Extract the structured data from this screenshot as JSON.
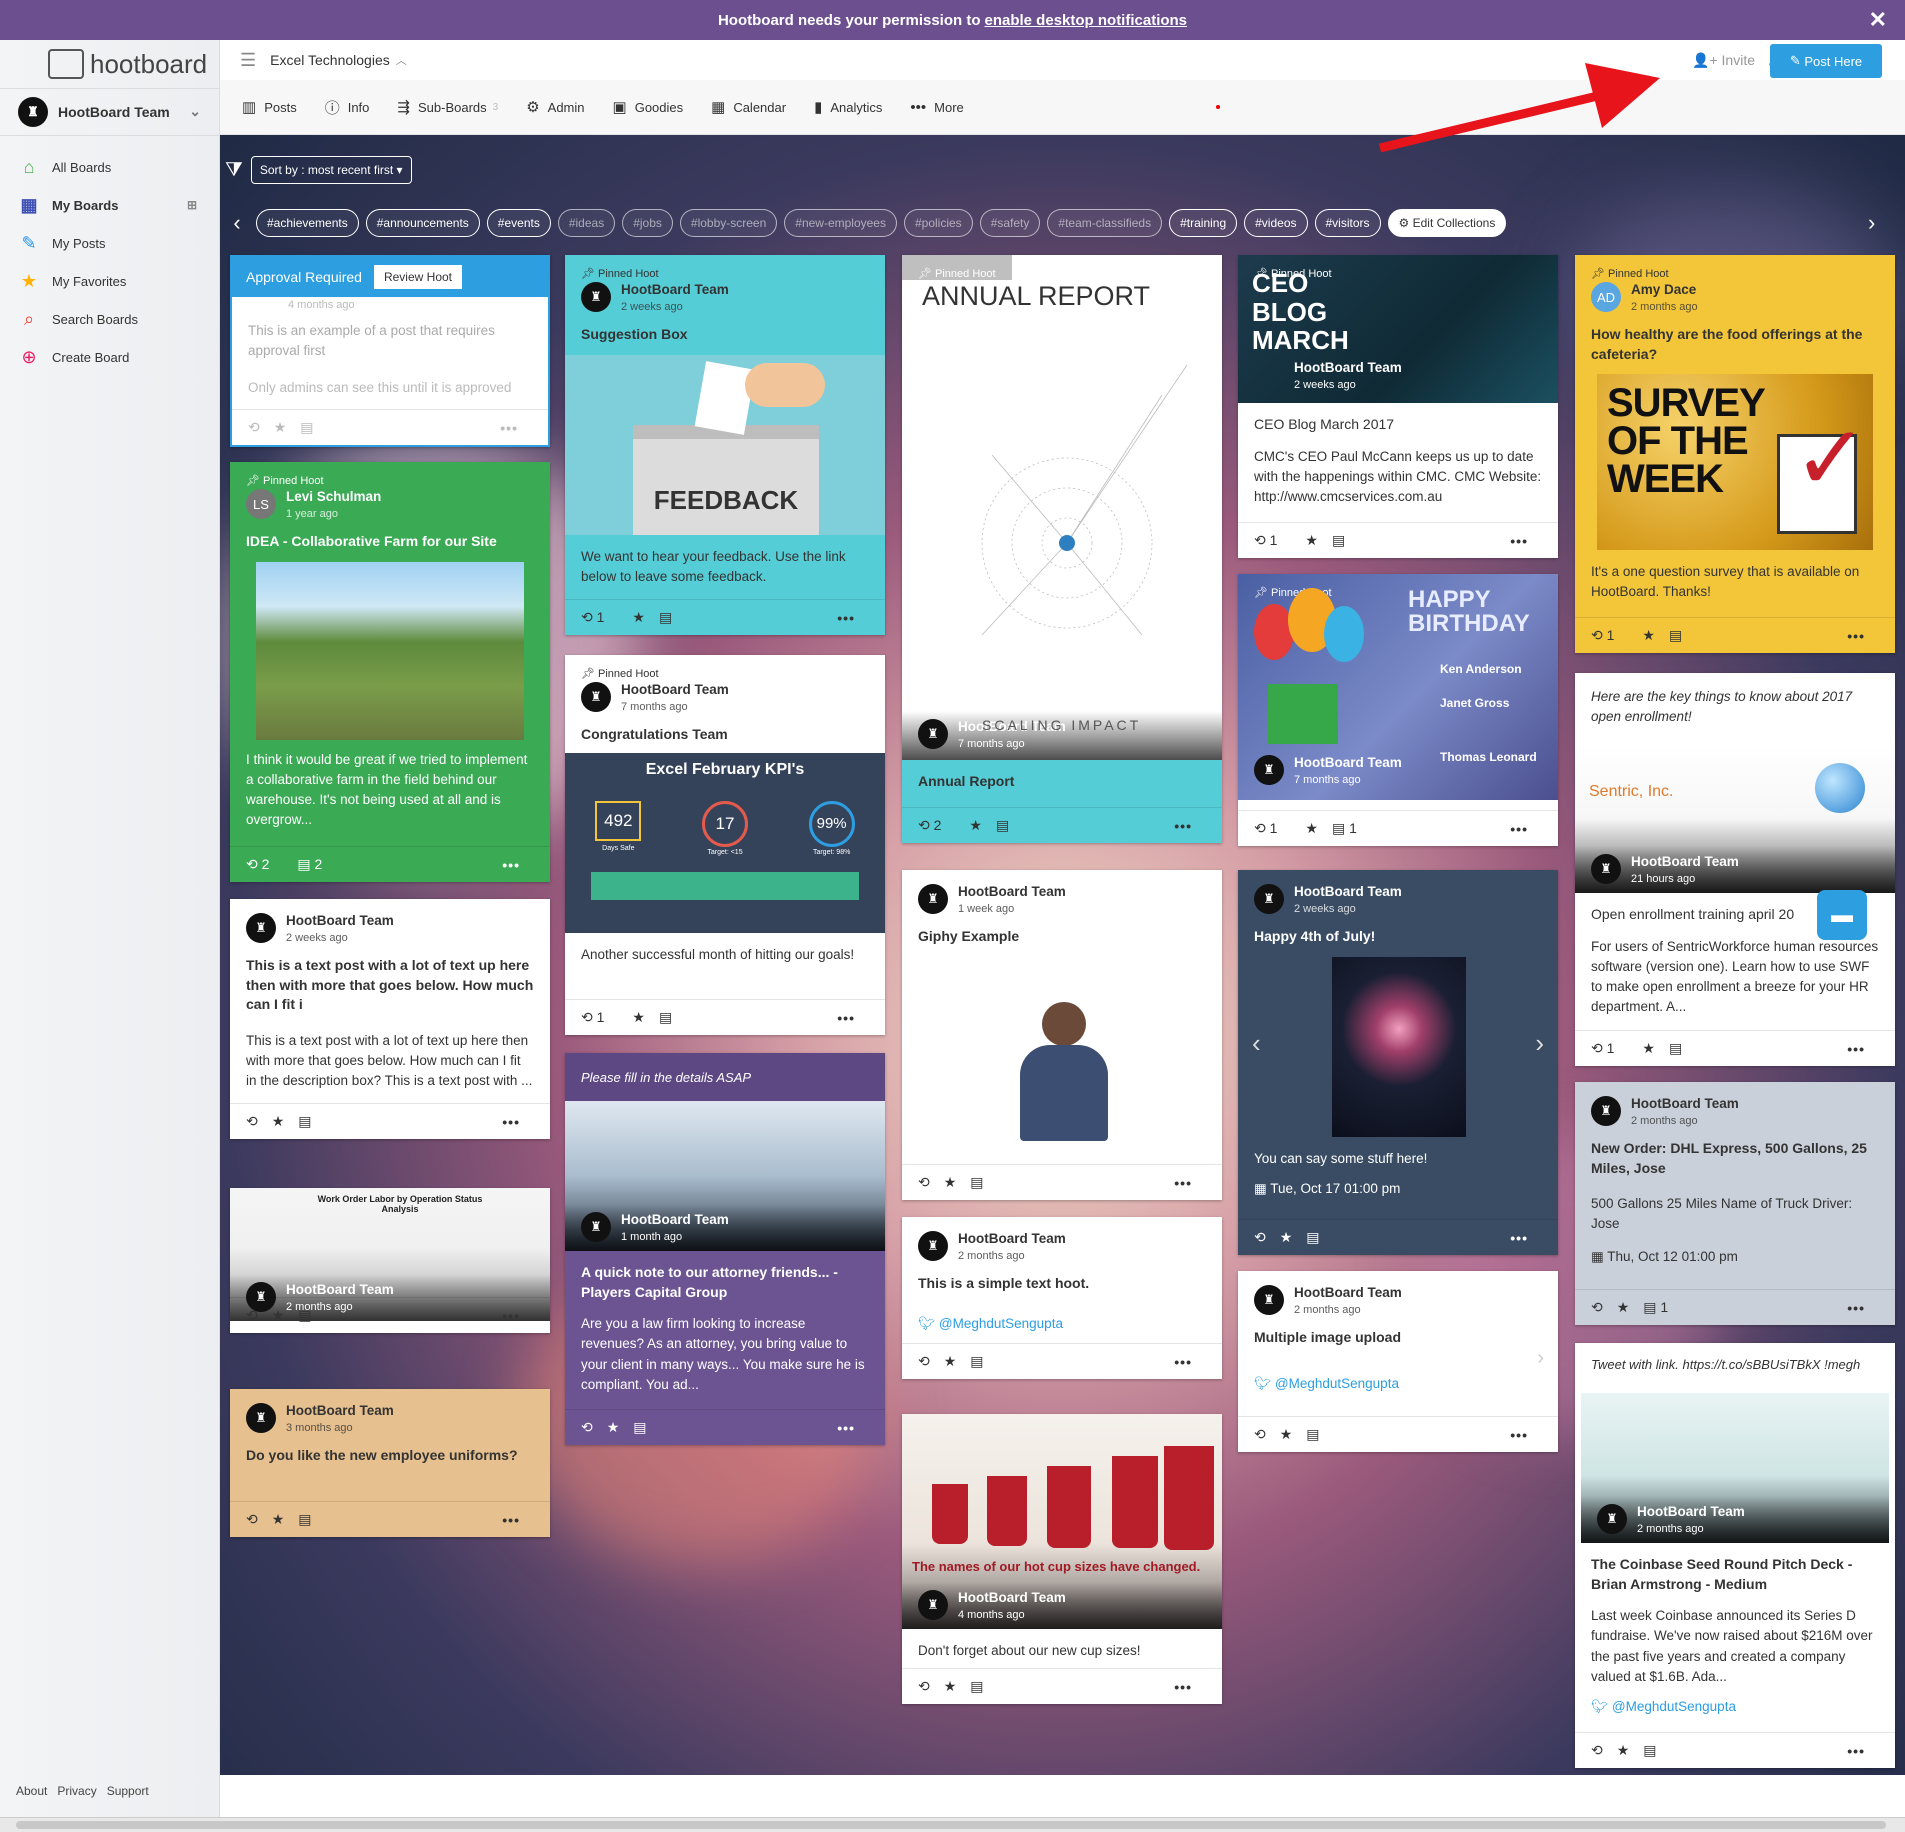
{
  "banner": {
    "text": "Hootboard needs your permission to",
    "link": "enable desktop notifications"
  },
  "app": {
    "logo": "hootboard",
    "team": "HootBoard Team",
    "board": "Excel Technologies"
  },
  "sidebar": {
    "items": [
      {
        "label": "All Boards",
        "icon": "home-icon",
        "color": "#4caf50"
      },
      {
        "label": "My Boards",
        "icon": "boards-icon",
        "color": "#3f51b5"
      },
      {
        "label": "My Posts",
        "icon": "edit-icon",
        "color": "#2196f3"
      },
      {
        "label": "My Favorites",
        "icon": "star-icon",
        "color": "#ffb300"
      },
      {
        "label": "Search Boards",
        "icon": "search-icon",
        "color": "#f44336"
      },
      {
        "label": "Create Board",
        "icon": "plus-icon",
        "color": "#e91e63"
      }
    ],
    "footer": [
      "About",
      "Privacy",
      "Support"
    ]
  },
  "top": {
    "invite": "Invite",
    "post": "Post Here"
  },
  "tabs": [
    {
      "label": "Posts",
      "icon": "▥"
    },
    {
      "label": "Info",
      "icon": "ⓘ"
    },
    {
      "label": "Sub-Boards",
      "icon": "⇶",
      "count": "3"
    },
    {
      "label": "Admin",
      "icon": "⚙"
    },
    {
      "label": "Goodies",
      "icon": "▣"
    },
    {
      "label": "Calendar",
      "icon": "▦"
    },
    {
      "label": "Analytics",
      "icon": "▮"
    },
    {
      "label": "More",
      "icon": "•••"
    }
  ],
  "sort": "Sort by : most recent first",
  "tags": [
    "#achievements",
    "#announcements",
    "#events",
    "#ideas",
    "#jobs",
    "#lobby-screen",
    "#new-employees",
    "#policies",
    "#safety",
    "#team-classifieds",
    "#training",
    "#videos",
    "#visitors"
  ],
  "edit_collections": "Edit Collections",
  "cards": {
    "approval": {
      "label": "Approval Required",
      "review": "Review Hoot",
      "time": "4 months ago",
      "text": "This is an example of a post that requires approval first",
      "note": "Only admins can see this until it is approved"
    },
    "levi": {
      "pin": "Pinned Hoot",
      "name": "Levi Schulman",
      "time": "1 year ago",
      "title": "IDEA - Collaborative Farm for our Site",
      "text": "I think it would be great if we tried to implement a collaborative farm in the field behind our warehouse. It's not being used at all and is overgrow...",
      "r": "2",
      "c": "2"
    },
    "textpost": {
      "name": "HootBoard Team",
      "time": "2 weeks ago",
      "title": "This is a text post with a lot of text up here then with more that goes below. How much can I fit i",
      "text": "This is a text post with a lot of text up here then with more that goes below. How much can I fit in the description box? This is a text post with ..."
    },
    "workorder": {
      "name": "HootBoard Team",
      "time": "2 months ago",
      "img_title": "Work Order Labor by Operation Status Analysis"
    },
    "uniform": {
      "name": "HootBoard Team",
      "time": "3 months ago",
      "title": "Do you like the new employee uniforms?"
    },
    "suggest": {
      "pin": "Pinned Hoot",
      "name": "HootBoard Team",
      "time": "2 weeks ago",
      "title": "Suggestion Box",
      "img": "FEEDBACK",
      "text": "We want to hear your feedback. Use the link below to leave some feedback.",
      "r": "1"
    },
    "congrats": {
      "pin": "Pinned Hoot",
      "name": "HootBoard Team",
      "time": "7 months ago",
      "title": "Congratulations Team",
      "kpi_title": "Excel February KPI's",
      "k1": "492",
      "k2": "17",
      "k3": "99%",
      "k1l": "Days Safe",
      "k2l": "Target: <15",
      "k3l": "Target: 98%",
      "text": "Another successful month of hitting our goals!",
      "r": "1"
    },
    "attorney": {
      "header": "Please fill in the details ASAP",
      "name": "HootBoard Team",
      "time": "1 month ago",
      "title": "A quick note to our attorney friends... - Players Capital Group",
      "text": "Are you a law firm looking to increase revenues? As an attorney, you bring value to your client in many ways... You make sure he is compliant. You ad..."
    },
    "annual": {
      "pin": "Pinned Hoot",
      "img_title": "ANNUAL REPORT",
      "img_sub": "SCALING IMPACT",
      "name": "HootBoard Team",
      "time": "7 months ago",
      "title": "Annual Report",
      "r": "2"
    },
    "giphy": {
      "name": "HootBoard Team",
      "time": "1 week ago",
      "title": "Giphy Example"
    },
    "simple": {
      "name": "HootBoard Team",
      "time": "2 months ago",
      "title": "This is a simple text hoot.",
      "tw": "@MeghdutSengupta"
    },
    "cups": {
      "name": "HootBoard Team",
      "time": "4 months ago",
      "img_title": "The names of our hot cup sizes have changed.",
      "text": "Don't forget about our new cup sizes!"
    },
    "ceo": {
      "pin": "Pinned Hoot",
      "img_title": "CEO BLOG MARCH",
      "name": "HootBoard Team",
      "time": "2 weeks ago",
      "title": "CEO Blog March 2017",
      "text": "CMC's CEO Paul McCann keeps us up to date with the happenings within CMC. CMC Website: http://www.cmcservices.com.au",
      "r": "1"
    },
    "birthday": {
      "pin": "Pinned Hoot",
      "img_title": "HAPPY BIRTHDAY",
      "p1": "Ken Anderson",
      "p2": "Janet Gross",
      "p3": "Thomas Leonard",
      "name": "HootBoard Team",
      "time": "7 months ago",
      "r": "1",
      "c": "1"
    },
    "july": {
      "name": "HootBoard Team",
      "time": "2 weeks ago",
      "title": "Happy 4th of July!",
      "text": "You can say some stuff here!",
      "date": "Tue, Oct 17 01:00 pm"
    },
    "multi": {
      "name": "HootBoard Team",
      "time": "2 months ago",
      "title": "Multiple image upload",
      "tw": "@MeghdutSengupta"
    },
    "survey": {
      "pin": "Pinned Hoot",
      "av": "AD",
      "name": "Amy Dace",
      "time": "2 months ago",
      "title": "How healthy are the food offerings at the cafeteria?",
      "img": "SURVEY OF THE WEEK",
      "text": "It's a one question survey that is available on HootBoard. Thanks!",
      "r": "1"
    },
    "enroll": {
      "header": "Here are the key things to know about 2017 open enrollment!",
      "logo": "Sentric, Inc.",
      "name": "HootBoard Team",
      "time": "21 hours ago",
      "title": "Open enrollment training april 20",
      "text": "For users of SentricWorkforce human resources software (version one). Learn how to use SWF to make open enrollment a breeze for your HR department. A...",
      "r": "1"
    },
    "dhl": {
      "name": "HootBoard Team",
      "time": "2 months ago",
      "title": "New Order: DHL Express, 500 Gallons, 25 Miles, Jose",
      "text": "500 Gallons 25 Miles Name of Truck Driver: Jose",
      "date": "Thu, Oct 12 01:00 pm",
      "c": "1"
    },
    "coinbase": {
      "header": "Tweet with link. https://t.co/sBBUsiTBkX !megh",
      "name": "HootBoard Team",
      "time": "2 months ago",
      "title": "The Coinbase Seed Round Pitch Deck - Brian Armstrong - Medium",
      "text": "Last week Coinbase announced its Series D fundraise. We've now raised about $216M over the past five years and created a company valued at $1.6B. Ada...",
      "tw": "@MeghdutSengupta"
    }
  }
}
